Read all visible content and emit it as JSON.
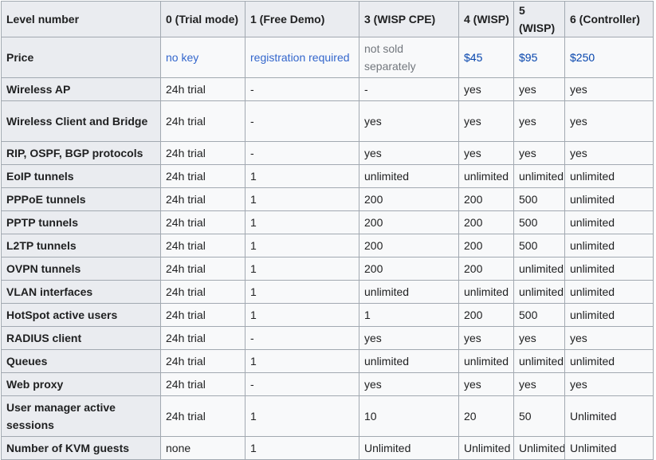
{
  "header": {
    "feature": "Level number",
    "levels": [
      "0 (Trial mode)",
      "1 (Free Demo)",
      "3 (WISP CPE)",
      "4 (WISP)",
      "5 (WISP)",
      "6 (Controller)"
    ]
  },
  "price": {
    "label": "Price",
    "l0": "no key",
    "l1": "registration required",
    "l3": "not sold separately",
    "l4": "$45",
    "l5": "$95",
    "l6": "$250"
  },
  "rows": [
    {
      "feature": "Wireless AP",
      "values": [
        "24h trial",
        "-",
        "-",
        "yes",
        "yes",
        "yes"
      ]
    },
    {
      "feature": "Wireless Client and Bridge",
      "values": [
        "24h trial",
        "-",
        "yes",
        "yes",
        "yes",
        "yes"
      ]
    },
    {
      "feature": "RIP, OSPF, BGP protocols",
      "values": [
        "24h trial",
        "-",
        "yes",
        "yes",
        "yes",
        "yes"
      ]
    },
    {
      "feature": "EoIP tunnels",
      "values": [
        "24h trial",
        "1",
        "unlimited",
        "unlimited",
        "unlimited",
        "unlimited"
      ]
    },
    {
      "feature": "PPPoE tunnels",
      "values": [
        "24h trial",
        "1",
        "200",
        "200",
        "500",
        "unlimited"
      ]
    },
    {
      "feature": "PPTP tunnels",
      "values": [
        "24h trial",
        "1",
        "200",
        "200",
        "500",
        "unlimited"
      ]
    },
    {
      "feature": "L2TP tunnels",
      "values": [
        "24h trial",
        "1",
        "200",
        "200",
        "500",
        "unlimited"
      ]
    },
    {
      "feature": "OVPN tunnels",
      "values": [
        "24h trial",
        "1",
        "200",
        "200",
        "unlimited",
        "unlimited"
      ]
    },
    {
      "feature": "VLAN interfaces",
      "values": [
        "24h trial",
        "1",
        "unlimited",
        "unlimited",
        "unlimited",
        "unlimited"
      ]
    },
    {
      "feature": "HotSpot active users",
      "values": [
        "24h trial",
        "1",
        "1",
        "200",
        "500",
        "unlimited"
      ]
    },
    {
      "feature": "RADIUS client",
      "values": [
        "24h trial",
        "-",
        "yes",
        "yes",
        "yes",
        "yes"
      ]
    },
    {
      "feature": "Queues",
      "values": [
        "24h trial",
        "1",
        "unlimited",
        "unlimited",
        "unlimited",
        "unlimited"
      ]
    },
    {
      "feature": "Web proxy",
      "values": [
        "24h trial",
        "-",
        "yes",
        "yes",
        "yes",
        "yes"
      ]
    },
    {
      "feature": "User manager active sessions",
      "values": [
        "24h trial",
        "1",
        "10",
        "20",
        "50",
        "Unlimited"
      ]
    },
    {
      "feature": "Number of KVM guests",
      "values": [
        "none",
        "1",
        "Unlimited",
        "Unlimited",
        "Unlimited",
        "Unlimited"
      ]
    }
  ],
  "colors": {
    "header_bg": "#eaecf0",
    "cell_bg": "#f8f9fa",
    "border": "#a2a9b1",
    "link": "#3366cc",
    "price_link": "#0645ad",
    "muted_text": "#72777d"
  }
}
